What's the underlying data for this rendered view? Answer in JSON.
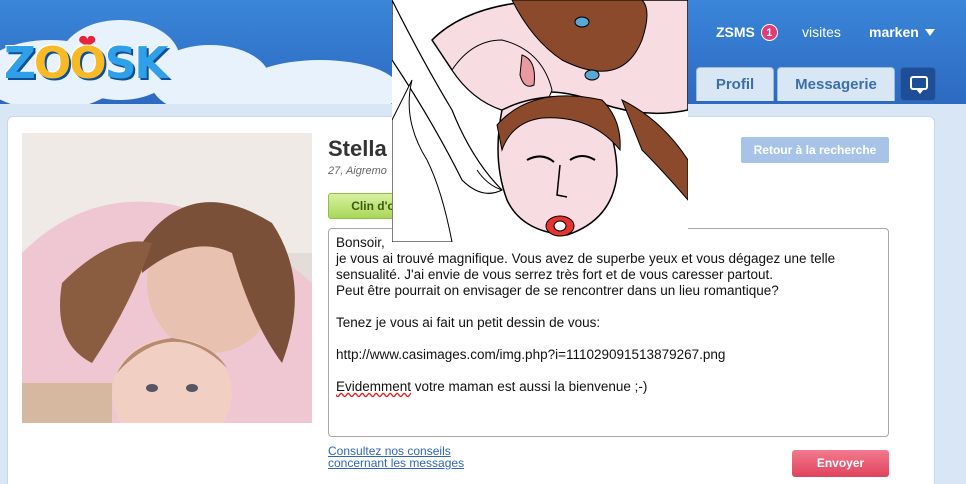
{
  "brand": {
    "logo_text_a": "Z",
    "logo_text_o": "OO",
    "logo_text_b": "SK"
  },
  "topnav": {
    "zsms": "ZSMS",
    "zsms_badge": "1",
    "visites": "visites",
    "username": "marken"
  },
  "tabs": {
    "profil": "Profil",
    "messagerie": "Messagerie"
  },
  "profile": {
    "name": "Stella",
    "subtitle": "27, Aigremo",
    "wink_label": "Clin d'o"
  },
  "actions": {
    "back_label": "Retour à la recherche",
    "send_label": "Envoyer",
    "tips_label": "Consultez nos conseils concernant les messages"
  },
  "message": {
    "line1": "Bonsoir,",
    "line2": "je vous ai trouvé magnifique. Vous avez de superbe yeux et vous dégagez une telle sensualité. J'ai envie de vous serrez très fort et de vous caresser partout.",
    "line3": "Peut être pourrait on envisager de se rencontrer dans un lieu romantique?",
    "line4": "Tenez je vous ai fait un petit dessin de vous:",
    "line5": "http://www.casimages.com/img.php?i=111029091513879267.png",
    "line6_word": "Evidemment",
    "line6_rest": " votre maman est aussi la bienvenue ;-)"
  },
  "colors": {
    "header": "#2c68c0",
    "send": "#e0435c",
    "back": "#a7c4e8",
    "link": "#2f67b5"
  }
}
